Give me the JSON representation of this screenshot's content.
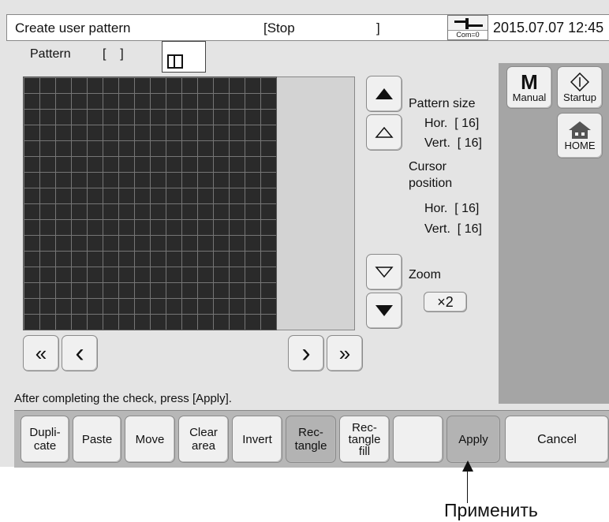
{
  "header": {
    "title": "Create user pattern",
    "status": "[Stop",
    "status_close": "]",
    "com_label": "Com=0",
    "datetime": "2015.07.07 12:45"
  },
  "pattern": {
    "label": "Pattern",
    "value": "[    ]"
  },
  "info": {
    "pattern_size_label": "Pattern size",
    "size_hor": "Hor.  [ 16]",
    "size_vert": "Vert.  [ 16]",
    "cursor_label_1": "Cursor",
    "cursor_label_2": "position",
    "cursor_hor": "Hor.  [ 16]",
    "cursor_vert": "Vert.  [ 16]",
    "zoom_label": "Zoom",
    "zoom_value": "×2"
  },
  "side_buttons": {
    "manual_icon": "M",
    "manual_label": "Manual",
    "startup_label": "Startup",
    "home_label": "HOME"
  },
  "nav": {
    "first": "«",
    "prev": "‹",
    "next": "›",
    "last": "»"
  },
  "message": "After completing the check, press [Apply].",
  "toolbar": {
    "duplicate_1": "Dupli-",
    "duplicate_2": "cate",
    "paste": "Paste",
    "move": "Move",
    "clear_1": "Clear",
    "clear_2": "area",
    "invert": "Invert",
    "rect_1": "Rec-",
    "rect_2": "tangle",
    "rectfill_1": "Rec-",
    "rectfill_2": "tangle",
    "rectfill_3": "fill",
    "apply": "Apply",
    "cancel": "Cancel"
  },
  "callout": "Применить"
}
